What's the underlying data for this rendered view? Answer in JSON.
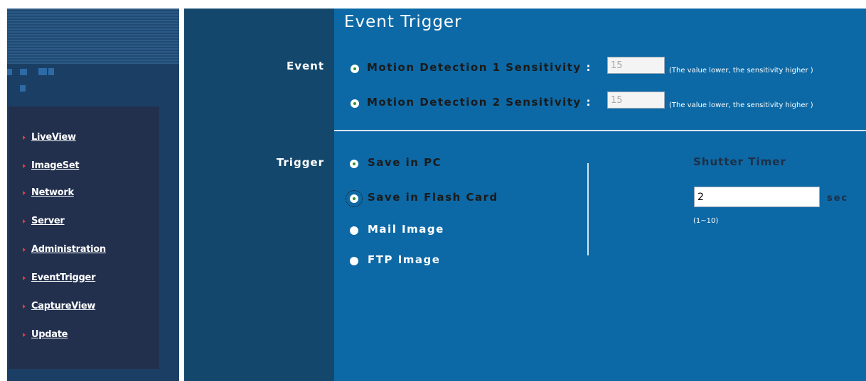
{
  "sidebar": {
    "items": [
      {
        "label": "LiveView"
      },
      {
        "label": "ImageSet"
      },
      {
        "label": "Network"
      },
      {
        "label": "Server"
      },
      {
        "label": "Administration"
      },
      {
        "label": "EventTrigger"
      },
      {
        "label": "CaptureView"
      },
      {
        "label": "Update"
      }
    ]
  },
  "labels": {
    "event": "Event",
    "trigger": "Trigger"
  },
  "main": {
    "title": "Event Trigger",
    "event": {
      "items": [
        {
          "label": "Motion Detection 1 Sensitivity",
          "colon": ":",
          "value": "15",
          "checked": true,
          "hint": "(The value lower, the sensitivity higher )"
        },
        {
          "label": "Motion Detection 2 Sensitivity",
          "colon": ":",
          "value": "15",
          "checked": true,
          "hint": "(The value lower, the sensitivity higher )"
        }
      ]
    },
    "trigger": {
      "options": [
        {
          "label": "Save in PC",
          "checked": true
        },
        {
          "label": "Save in Flash Card",
          "checked": true
        },
        {
          "label": "Mail Image",
          "checked": false
        },
        {
          "label": "FTP Image",
          "checked": false
        }
      ]
    },
    "shutter": {
      "title": "Shutter Timer",
      "value": "2",
      "unit": "sec",
      "range": "(1~10)"
    }
  },
  "colors": {
    "content_bg": "#0c69a6",
    "label_col_bg": "#13486c",
    "sidebar_bg": "#1b3f64",
    "nav_panel_bg": "#22304e",
    "nav_arrow": "#e0403a",
    "radio_dot": "#2f8f2f"
  }
}
